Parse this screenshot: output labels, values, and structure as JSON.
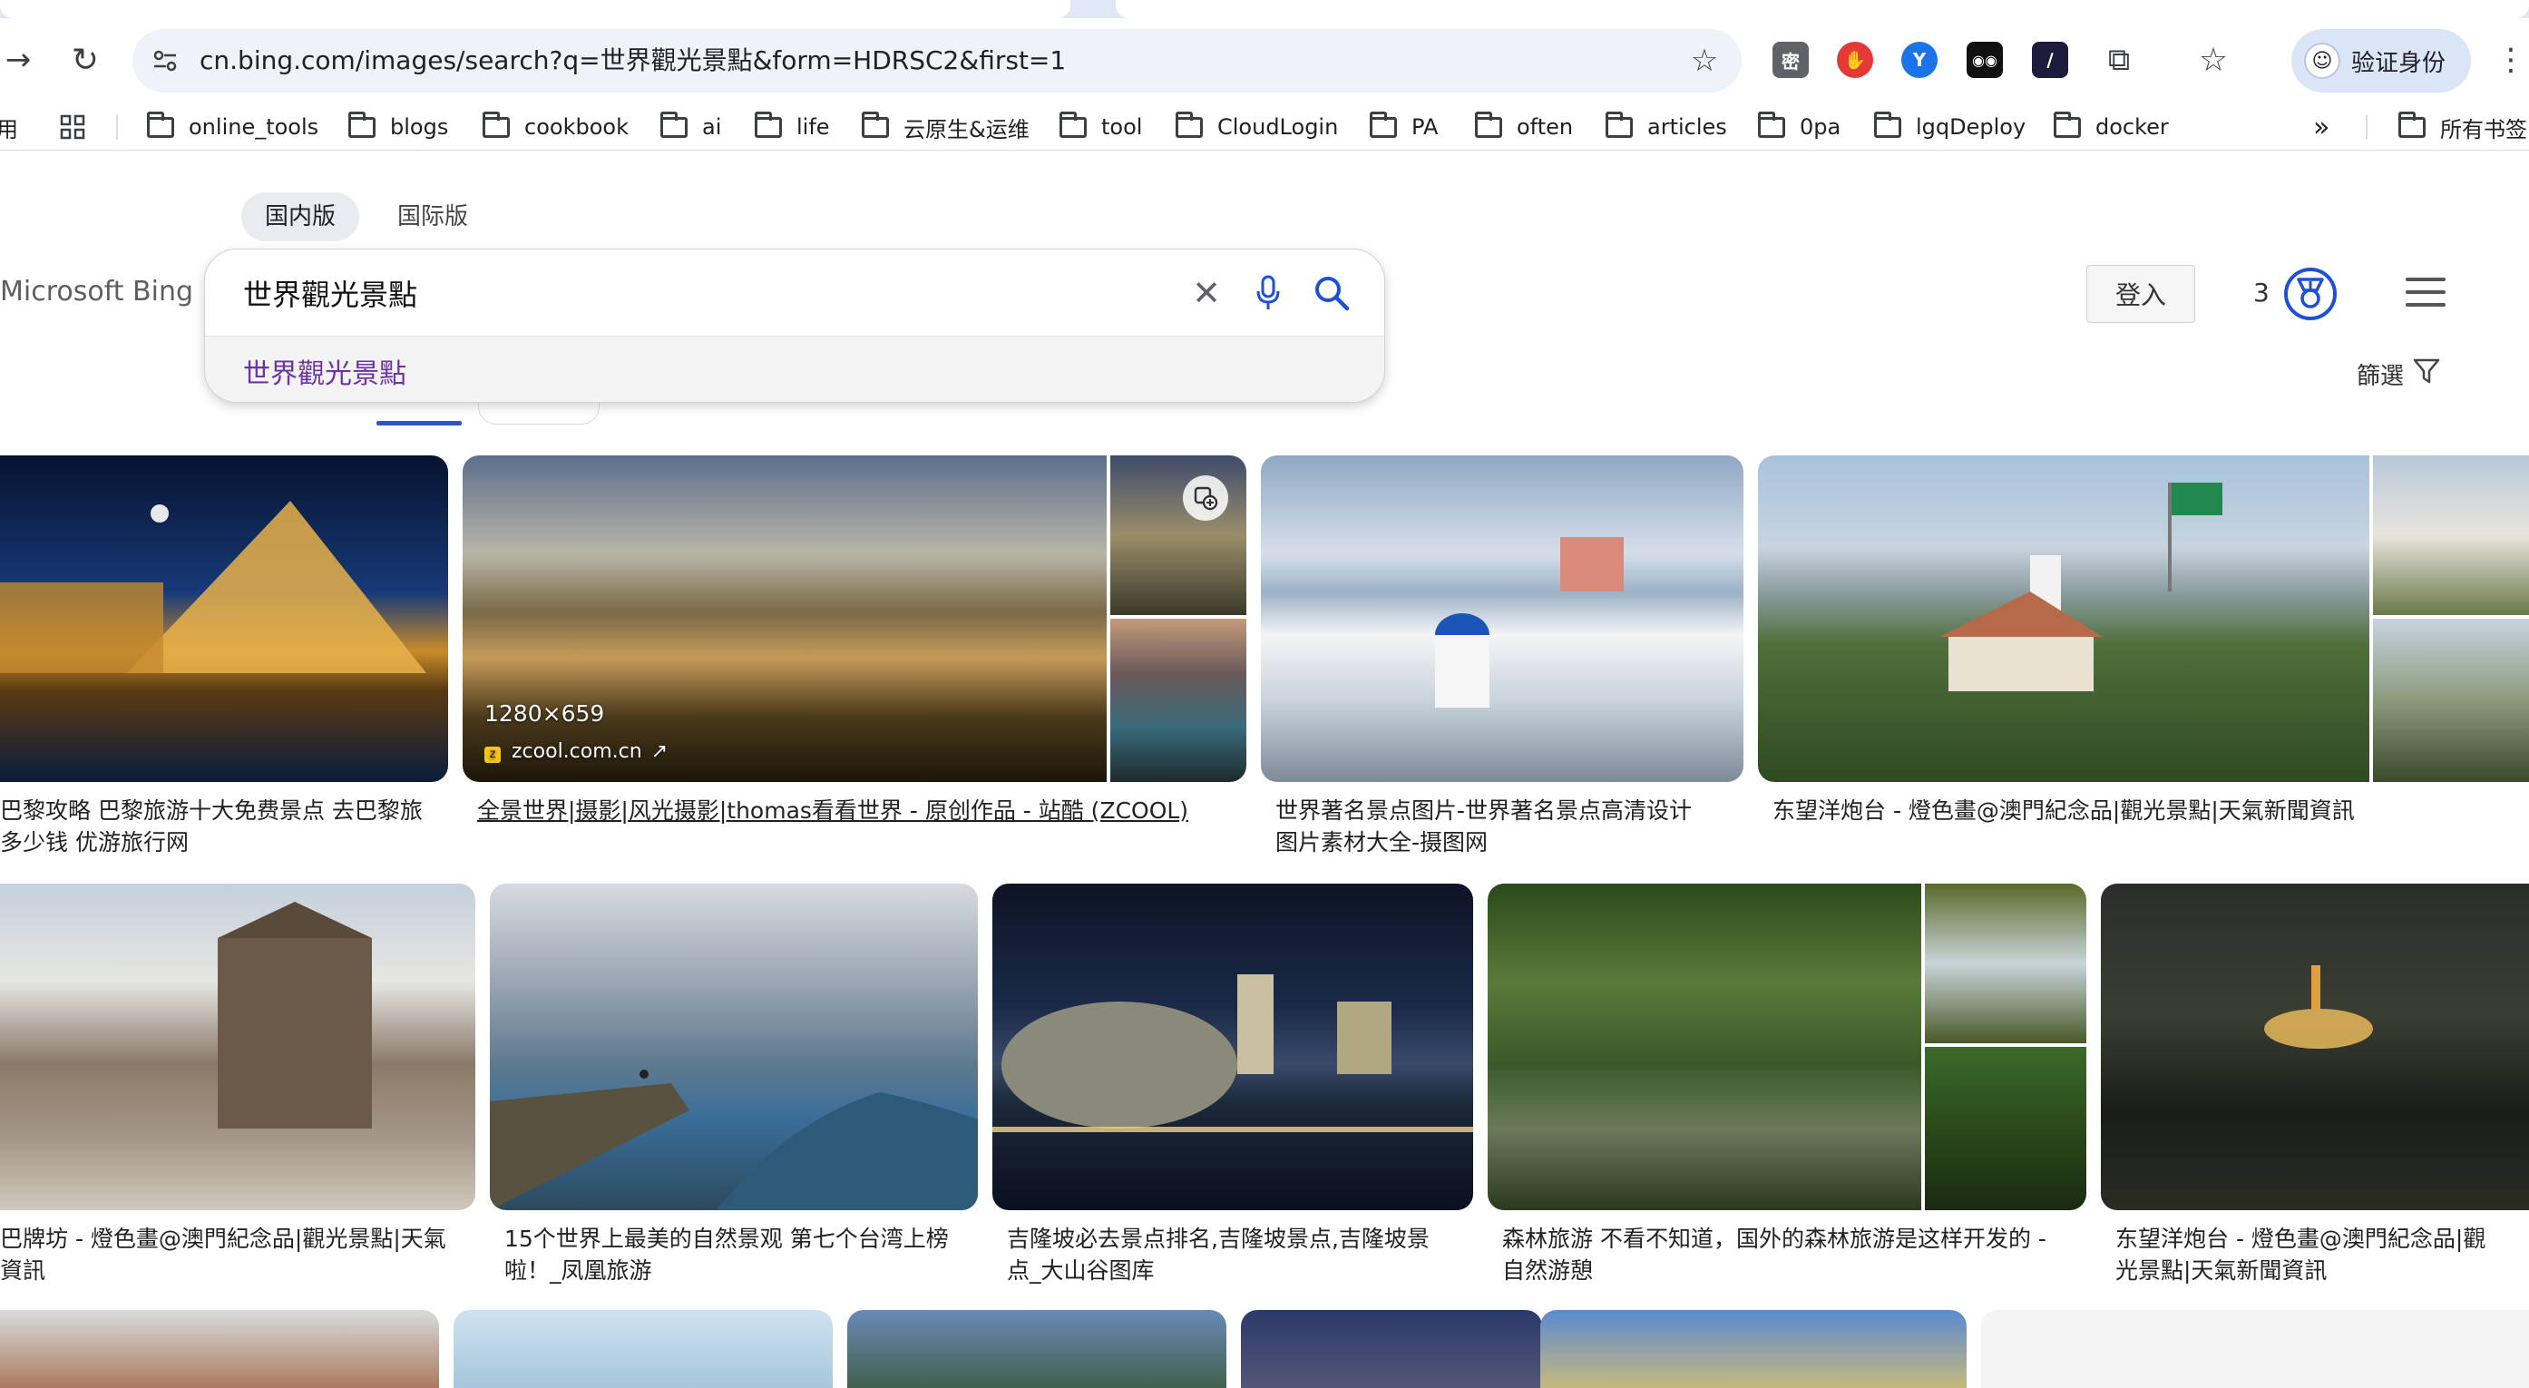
{
  "browser": {
    "url": "cn.bing.com/images/search?q=世界觀光景點&form=HDRSC2&first=1",
    "profile_button": "验证身份",
    "bookmarks": [
      "用",
      "online_tools",
      "blogs",
      "cookbook",
      "ai",
      "life",
      "云原生&运维",
      "tool",
      "CloudLogin",
      "PA",
      "often",
      "articles",
      "0pa",
      "lgqDeploy",
      "docker"
    ],
    "bookmarks_overflow": "»",
    "all_bookmarks": "所有书签",
    "extensions": [
      {
        "icon": "密",
        "color": "#5f6368"
      },
      {
        "icon": "✋",
        "color": "#e53935"
      },
      {
        "icon": "Y",
        "color": "#1a73e8"
      },
      {
        "icon": "◉◉",
        "color": "#111111"
      },
      {
        "icon": "∕",
        "color": "#1c1c3c"
      }
    ]
  },
  "bing": {
    "region_tabs": [
      "国内版",
      "国际版"
    ],
    "logo": "Microsoft Bing",
    "search_query": "世界觀光景點",
    "suggestion": "世界觀光景點",
    "signin": "登入",
    "reward_points": "3",
    "filter_label": "篩選"
  },
  "results": {
    "row1": [
      {
        "caption": "巴黎攻略 巴黎旅游十大免费景点 去巴黎旅\n多少钱 优游旅行网",
        "hover": false
      },
      {
        "caption": "全景世界|摄影|风光摄影|thomas看看世界 - 原创作品 - 站酷 (ZCOOL)",
        "hover": true,
        "size": "1280×659",
        "source": "zcool.com.cn"
      },
      {
        "caption": "世界著名景点图片-世界著名景点高清设计\n图片素材大全-摄图网",
        "hover": false
      },
      {
        "caption": "东望洋炮台 - 燈色畫@澳門紀念品|觀光景點|天氣新聞資訊",
        "hover": false
      }
    ],
    "row2": [
      {
        "caption": "巴牌坊 - 燈色畫@澳門紀念品|觀光景點|天氣\n資訊"
      },
      {
        "caption": "15个世界上最美的自然景观 第七个台湾上榜\n啦！_凤凰旅游"
      },
      {
        "caption": "吉隆坡必去景点排名,吉隆坡景点,吉隆坡景\n点_大山谷图库"
      },
      {
        "caption": "森林旅游 不看不知道，国外的森林旅游是这样开发的 -\n自然游憩"
      },
      {
        "caption": "东望洋炮台 - 燈色畫@澳門紀念品|觀\n光景點|天氣新聞資訊"
      }
    ]
  },
  "colors": {
    "accent": "#1e4fd6",
    "suggestion": "#6b33a6",
    "omnibox_bg": "#eef2f9"
  }
}
